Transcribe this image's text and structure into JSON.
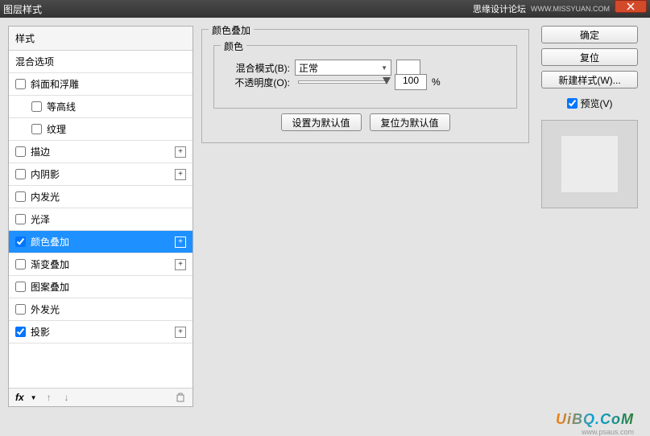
{
  "titlebar": {
    "title": "图层样式",
    "credit": "思缘设计论坛",
    "url": "WWW.MISSYUAN.COM"
  },
  "sidebar": {
    "header": "样式",
    "blending": "混合选项",
    "items": [
      {
        "label": "斜面和浮雕",
        "checked": false,
        "plus": false,
        "indent": false
      },
      {
        "label": "等高线",
        "checked": false,
        "plus": false,
        "indent": true
      },
      {
        "label": "纹理",
        "checked": false,
        "plus": false,
        "indent": true
      },
      {
        "label": "描边",
        "checked": false,
        "plus": true,
        "indent": false
      },
      {
        "label": "内阴影",
        "checked": false,
        "plus": true,
        "indent": false
      },
      {
        "label": "内发光",
        "checked": false,
        "plus": false,
        "indent": false
      },
      {
        "label": "光泽",
        "checked": false,
        "plus": false,
        "indent": false
      },
      {
        "label": "颜色叠加",
        "checked": true,
        "plus": true,
        "indent": false,
        "selected": true
      },
      {
        "label": "渐变叠加",
        "checked": false,
        "plus": true,
        "indent": false
      },
      {
        "label": "图案叠加",
        "checked": false,
        "plus": false,
        "indent": false
      },
      {
        "label": "外发光",
        "checked": false,
        "plus": false,
        "indent": false
      },
      {
        "label": "投影",
        "checked": true,
        "plus": true,
        "indent": false
      }
    ],
    "footer_fx": "fx"
  },
  "panel": {
    "title": "颜色叠加",
    "color_section": "颜色",
    "blend_mode_label": "混合模式(B):",
    "blend_mode_value": "正常",
    "opacity_label": "不透明度(O):",
    "opacity_value": "100",
    "opacity_unit": "%",
    "set_default": "设置为默认值",
    "reset_default": "复位为默认值"
  },
  "right": {
    "ok": "确定",
    "cancel": "复位",
    "new_style": "新建样式(W)...",
    "preview": "预览(V)"
  },
  "watermark": {
    "main": "UiBQ.CoM",
    "sub": "www.psaus.com"
  }
}
